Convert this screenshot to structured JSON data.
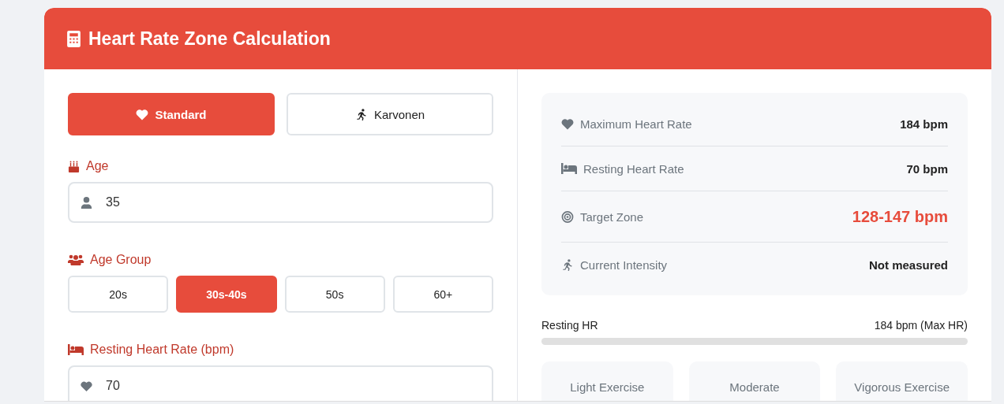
{
  "header": {
    "title": "Heart Rate Zone Calculation"
  },
  "methods": [
    {
      "label": "Standard",
      "selected": true
    },
    {
      "label": "Karvonen",
      "selected": false
    }
  ],
  "age": {
    "label": "Age",
    "value": "35"
  },
  "age_group": {
    "label": "Age Group",
    "options": [
      {
        "label": "20s",
        "selected": false
      },
      {
        "label": "30s-40s",
        "selected": true
      },
      {
        "label": "50s",
        "selected": false
      },
      {
        "label": "60+",
        "selected": false
      }
    ]
  },
  "resting": {
    "label": "Resting Heart Rate (bpm)",
    "value": "70"
  },
  "stats": [
    {
      "label": "Maximum Heart Rate",
      "value": "184 bpm",
      "kind": "plain"
    },
    {
      "label": "Resting Heart Rate",
      "value": "70 bpm",
      "kind": "plain"
    },
    {
      "label": "Target Zone",
      "value": "128-147 bpm",
      "kind": "highlight"
    },
    {
      "label": "Current Intensity",
      "value": "Not measured",
      "kind": "plain"
    }
  ],
  "range": {
    "left": "Resting HR",
    "right": "184 bpm (Max HR)"
  },
  "zones": [
    "Light Exercise",
    "Moderate",
    "Vigorous Exercise"
  ]
}
